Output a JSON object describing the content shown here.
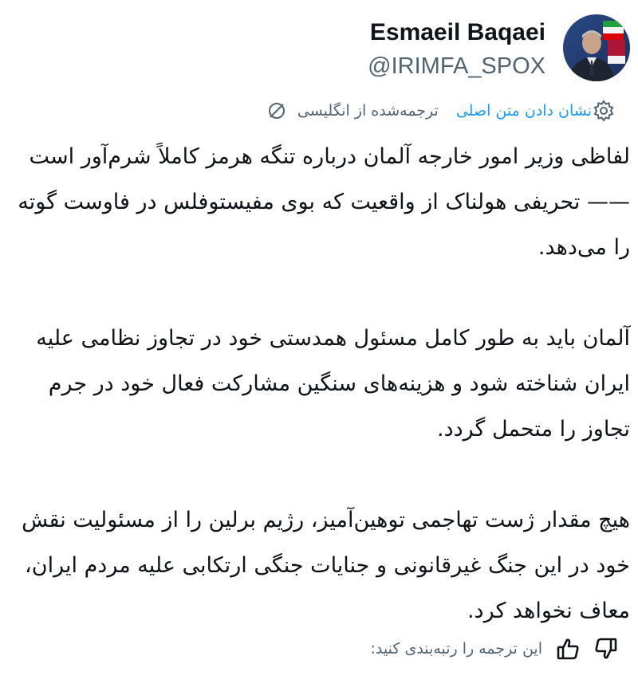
{
  "author": {
    "display_name": "Esmaeil Baqaei",
    "handle": "@IRIMFA_SPOX",
    "avatar_icon": "profile-photo"
  },
  "translation_bar": {
    "translated_label": "ترجمه‌شده از انگلیسی",
    "show_original_label": "نشان دادن متن اصلی",
    "globe_icon": "translate-globe-icon",
    "settings_icon": "gear-icon"
  },
  "tweet": {
    "paragraphs": [
      "لفاظی وزیر امور خارجه آلمان درباره تنگه هرمز کاملاً شرم‌آور است —— تحریفی هولناک از واقعیت که بوی مفیستوفلس در فاوست گوته را می‌دهد.",
      "آلمان باید به طور کامل مسئول همدستی خود در تجاوز نظامی علیه ایران شناخته شود و هزینه‌های سنگین مشارکت فعال خود در جرم تجاوز را متحمل گردد.",
      "هیچ مقدار ژست تهاجمی توهین‌آمیز، رژیم برلین را از مسئولیت نقش خود در این جنگ غیرقانونی و جنایات جنگی ارتکابی علیه مردم ایران، معاف نخواهد کرد."
    ]
  },
  "rating": {
    "label": "این ترجمه را رتبه‌بندی کنید:",
    "thumbs_up_icon": "thumbs-up-icon",
    "thumbs_down_icon": "thumbs-down-icon"
  },
  "colors": {
    "text": "#0f1419",
    "muted": "#536471",
    "link": "#1d9bf0"
  }
}
